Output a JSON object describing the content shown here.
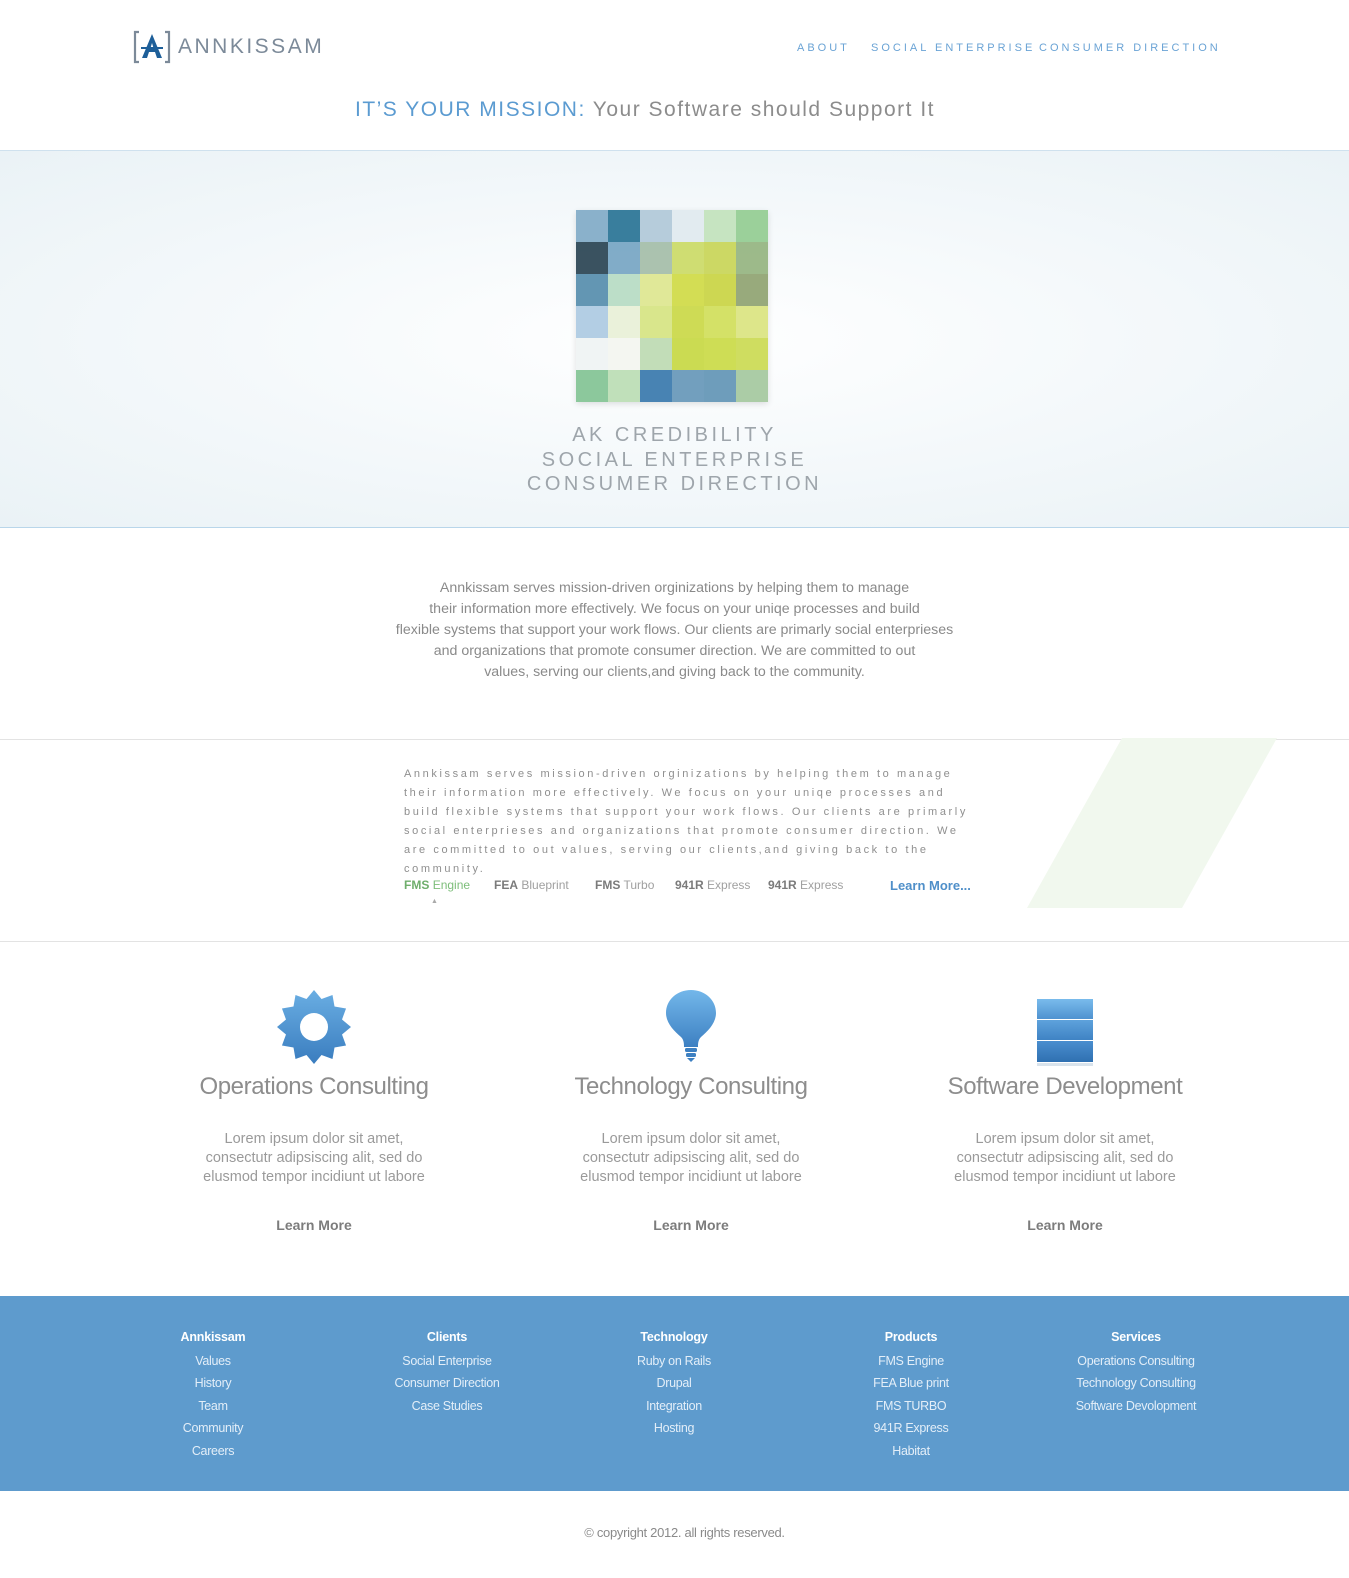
{
  "brand": {
    "name": "ANNKISSAM"
  },
  "nav": [
    {
      "label": "ABOUT"
    },
    {
      "label": "SOCIAL ENTERPRISE"
    },
    {
      "label": "CONSUMER DIRECTION"
    }
  ],
  "mission": {
    "highlight": "IT’S YOUR MISSION:",
    "rest": " Your Software should Support It"
  },
  "hero": {
    "lines": [
      "AK CREDIBILITY",
      "SOCIAL ENTERPRISE",
      "CONSUMER DIRECTION"
    ],
    "mosaic_colors": [
      "#7ba6c4",
      "#1f6c90",
      "#adc5d6",
      "#dfe8ee",
      "#bfe0b8",
      "#8ec98c",
      "#1f3a4a",
      "#6fa0c0",
      "#9fb9a4",
      "#c8d85e",
      "#c5d34e",
      "#8fb07a",
      "#4d88a8",
      "#b3d9c0",
      "#dce58a",
      "#cdd83c",
      "#c6d23a",
      "#8a9e6a",
      "#a9c7e0",
      "#e7efd5",
      "#d4e27c",
      "#c7d63e",
      "#cedd52",
      "#d8e27a",
      "#eef2f3",
      "#f2f5ef",
      "#b9d8ae",
      "#c4d63a",
      "#c7d83e",
      "#c8d84a",
      "#7cc08e",
      "#b7dcb0",
      "#2f72a8",
      "#5f92b5",
      "#5a8fb2",
      "#9fc59a"
    ]
  },
  "about": {
    "lines": [
      "Annkissam serves mission-driven orginizations by helping them to manage",
      "their information more effectively. We focus on your uniqe processes  and build",
      "flexible systems that support your work flows. Our clients are primarly social enterprieses",
      "and organizations that promote consumer direction.  We are committed to out",
      "values, serving our clients,and giving back to the community."
    ]
  },
  "products": {
    "lines": [
      "Annkissam serves mission-driven orginizations by helping them to manage",
      "their information more effectively. We focus on your uniqe processes  and",
      "build flexible systems that support your work flows. Our clients are primarly",
      "social enterprieses  and organizations that promote consumer direction. We",
      "are committed to out values, serving our clients,and giving back to the community."
    ],
    "items": [
      {
        "bold": "FMS",
        "light": "Engine"
      },
      {
        "bold": "FEA",
        "light": "Blueprint"
      },
      {
        "bold": "FMS",
        "light": "Turbo"
      },
      {
        "bold": "941R",
        "light": "Express"
      },
      {
        "bold": "941R",
        "light": "Express"
      }
    ],
    "learn_more": "Learn More..."
  },
  "services": [
    {
      "icon": "gear-icon",
      "title": "Operations Consulting",
      "desc": [
        "Lorem ipsum dolor sit amet,",
        "consectutr adipsiscing alit, sed do",
        "elusmod tempor incidiunt ut labore"
      ],
      "link": "Learn More"
    },
    {
      "icon": "lightbulb-icon",
      "title": "Technology Consulting",
      "desc": [
        "Lorem ipsum dolor sit amet,",
        "consectutr adipsiscing alit, sed do",
        "elusmod tempor incidiunt ut labore"
      ],
      "link": "Learn More"
    },
    {
      "icon": "stack-icon",
      "title": "Software Development",
      "desc": [
        "Lorem ipsum dolor sit amet,",
        "consectutr adipsiscing alit, sed do",
        "elusmod tempor incidiunt ut labore"
      ],
      "link": "Learn More"
    }
  ],
  "footer": {
    "columns": [
      {
        "heading": "Annkissam",
        "links": [
          "Values",
          "History",
          "Team",
          "Community",
          "Careers"
        ]
      },
      {
        "heading": "Clients",
        "links": [
          "Social Enterprise",
          "Consumer Direction",
          "Case Studies"
        ]
      },
      {
        "heading": "Technology",
        "links": [
          "Ruby on Rails",
          "Drupal",
          "Integration",
          "Hosting"
        ]
      },
      {
        "heading": "Products",
        "links": [
          "FMS Engine",
          "FEA Blue print",
          "FMS TURBO",
          "941R Express",
          "Habitat"
        ]
      },
      {
        "heading": "Services",
        "links": [
          "Operations Consulting",
          "Technology Consulting",
          "Software Devolopment"
        ]
      }
    ],
    "copyright": "© copyright 2012. all rights reserved."
  },
  "colors": {
    "accent": "#5e9bcd",
    "link": "#4f8fc9",
    "green": "#7dbe7a"
  }
}
